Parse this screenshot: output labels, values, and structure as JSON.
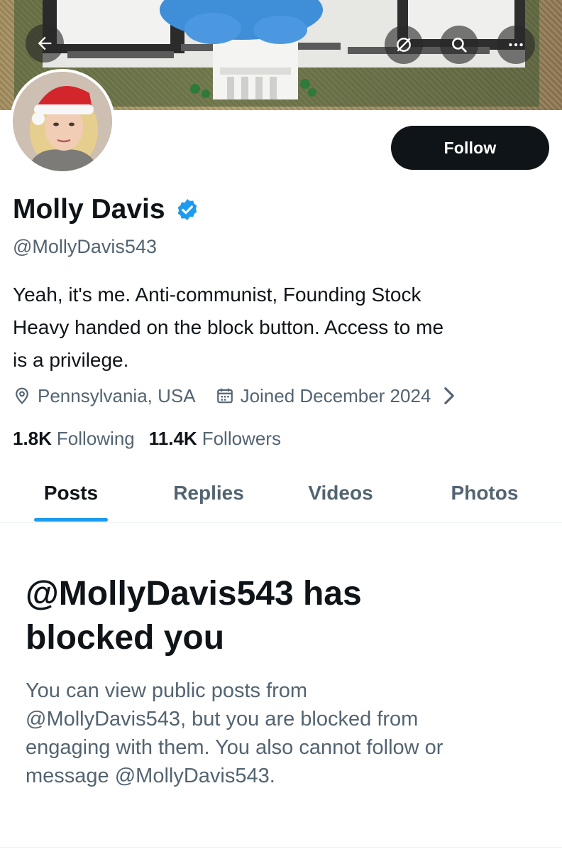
{
  "header": {
    "back_icon": "arrow-left-icon",
    "grok_icon": "grok-icon",
    "search_icon": "search-icon",
    "more_icon": "more-horizontal-icon"
  },
  "profile": {
    "follow_label": "Follow",
    "name": "Molly Davis",
    "verified_icon": "verified-badge-icon",
    "handle": "@MollyDavis543",
    "bio_lines": [
      "Yeah, it's me. Anti-communist, Founding Stock",
      "Heavy handed on the block button. Access to me",
      "is a privilege."
    ],
    "location": "Pennsylvania, USA",
    "joined": "Joined December 2024",
    "following_count": "1.8K",
    "following_label": "Following",
    "followers_count": "11.4K",
    "followers_label": "Followers"
  },
  "tabs": [
    {
      "label": "Posts",
      "active": true
    },
    {
      "label": "Replies",
      "active": false
    },
    {
      "label": "Videos",
      "active": false
    },
    {
      "label": "Photos",
      "active": false
    }
  ],
  "blocked": {
    "title_lines": [
      "@MollyDavis543 has",
      "blocked you"
    ],
    "body_lines": [
      "You can view public posts from",
      "@MollyDavis543, but you are blocked from",
      "engaging with them. You also cannot follow or",
      "message @MollyDavis543."
    ]
  },
  "colors": {
    "accent": "#1d9bf0",
    "text_primary": "#0f1419",
    "text_secondary": "#536471",
    "button_dark": "#0f1419"
  }
}
